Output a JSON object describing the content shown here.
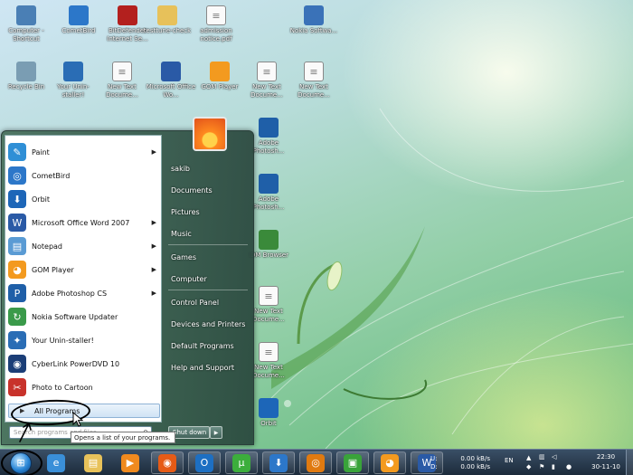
{
  "desktop_icons": [
    {
      "label": "Computer - Shortcut",
      "icon": "computer-icon",
      "color": "#4a7fb5"
    },
    {
      "label": "CometBird",
      "icon": "cometbird-icon",
      "color": "#2c77c9"
    },
    {
      "label": "BitDefender Internet Se...",
      "icon": "bitdefender-icon",
      "color": "#b3201e"
    },
    {
      "label": "testtune-check",
      "icon": "folder-icon",
      "color": "#e7c15a"
    },
    {
      "label": "admission notice.pdf",
      "icon": "pdf-icon",
      "color": "#d9d9d9"
    },
    {
      "label": "Nokia Softwa...",
      "icon": "nokia-icon",
      "color": "#3a72b8"
    },
    {
      "label": "Recycle Bin",
      "icon": "recycle-bin-icon",
      "color": "#7a9db3"
    },
    {
      "label": "Your Unin-staller!",
      "icon": "uninstaller-icon",
      "color": "#2a6db5"
    },
    {
      "label": "New Text Docume...",
      "icon": "text-document-icon",
      "color": "#ffffff"
    },
    {
      "label": "Microsoft Office Wo...",
      "icon": "word-icon",
      "color": "#2a5aa6"
    },
    {
      "label": "GOM Player",
      "icon": "gom-player-icon",
      "color": "#f39a1f"
    },
    {
      "label": "New Text Docume...",
      "icon": "text-document-icon",
      "color": "#ffffff"
    },
    {
      "label": "New Text Docume...",
      "icon": "text-document-icon",
      "color": "#ffffff"
    },
    {
      "label": "Adobe Photosh...",
      "icon": "photoshop-icon",
      "color": "#1f5fa8"
    },
    {
      "label": "Adobe Photosh...",
      "icon": "photoshop-icon",
      "color": "#1f5fa8"
    },
    {
      "label": "IDM Browser",
      "icon": "idm-icon",
      "color": "#3a8a3a"
    },
    {
      "label": "New Text Docume...",
      "icon": "text-document-icon",
      "color": "#ffffff"
    },
    {
      "label": "New Text Docume...",
      "icon": "text-document-icon",
      "color": "#ffffff"
    },
    {
      "label": "Orbit",
      "icon": "orbit-icon",
      "color": "#1d66b8"
    }
  ],
  "start_menu": {
    "programs": [
      {
        "label": "Paint",
        "icon": "paint-icon",
        "color": "#2f8fd6",
        "has_arrow": true
      },
      {
        "label": "CometBird",
        "icon": "cometbird-icon",
        "color": "#2c77c9",
        "has_arrow": false
      },
      {
        "label": "Orbit",
        "icon": "orbit-icon",
        "color": "#1d66b8",
        "has_arrow": false
      },
      {
        "label": "Microsoft Office Word 2007",
        "icon": "word-icon",
        "color": "#2a5aa6",
        "has_arrow": true
      },
      {
        "label": "Notepad",
        "icon": "notepad-icon",
        "color": "#5a9bd4",
        "has_arrow": true
      },
      {
        "label": "GOM Player",
        "icon": "gom-player-icon",
        "color": "#f39a1f",
        "has_arrow": true
      },
      {
        "label": "Adobe Photoshop CS",
        "icon": "photoshop-icon",
        "color": "#1f5fa8",
        "has_arrow": true
      },
      {
        "label": "Nokia Software Updater",
        "icon": "nokia-icon",
        "color": "#3a9a4a",
        "has_arrow": false
      },
      {
        "label": "Your Unin-staller!",
        "icon": "uninstaller-icon",
        "color": "#2a6db5",
        "has_arrow": false
      },
      {
        "label": "CyberLink PowerDVD 10",
        "icon": "powerdvd-icon",
        "color": "#1b3e77",
        "has_arrow": false
      },
      {
        "label": "Photo to Cartoon",
        "icon": "photo-to-cartoon-icon",
        "color": "#c8322b",
        "has_arrow": false
      }
    ],
    "all_programs": "All Programs",
    "search_placeholder": "Search programs and files",
    "right_items": [
      {
        "label": "sakib",
        "name": "right-item-user"
      },
      {
        "label": "Documents",
        "name": "right-item-documents"
      },
      {
        "label": "Pictures",
        "name": "right-item-pictures"
      },
      {
        "label": "Music",
        "name": "right-item-music"
      },
      {
        "label": "Games",
        "name": "right-item-games"
      },
      {
        "label": "Computer",
        "name": "right-item-computer"
      },
      {
        "label": "Control Panel",
        "name": "right-item-control-panel"
      },
      {
        "label": "Devices and Printers",
        "name": "right-item-devices-printers"
      },
      {
        "label": "Default Programs",
        "name": "right-item-default-programs"
      },
      {
        "label": "Help and Support",
        "name": "right-item-help-support"
      }
    ],
    "shutdown": "Shut down",
    "tooltip": "Opens a list of your programs."
  },
  "taskbar": {
    "pinned": [
      {
        "icon": "ie-icon",
        "color": "#3a8fd8",
        "glyph": "e"
      },
      {
        "icon": "explorer-icon",
        "color": "#e8c25a",
        "glyph": "▤"
      },
      {
        "icon": "media-player-icon",
        "color": "#f08a1e",
        "glyph": "▶"
      },
      {
        "icon": "firefox-icon",
        "color": "#e65b16",
        "glyph": "◉"
      },
      {
        "icon": "outlook-icon",
        "color": "#1d6fc2",
        "glyph": "O"
      },
      {
        "icon": "utorrent-icon",
        "color": "#3cae3c",
        "glyph": "µ"
      },
      {
        "icon": "idm-download-icon",
        "color": "#2c77c9",
        "glyph": "⬇"
      },
      {
        "icon": "cometbird-icon",
        "color": "#e07a10",
        "glyph": "◎"
      },
      {
        "icon": "nokia-pc-suite-icon",
        "color": "#39a33a",
        "glyph": "▣"
      },
      {
        "icon": "gom-player-icon",
        "color": "#f39a1f",
        "glyph": "◕"
      },
      {
        "icon": "word-icon",
        "color": "#2a5aa6",
        "glyph": "W"
      }
    ],
    "net_up_label": "U:",
    "net_up_value": "0.00 kB/s",
    "net_down_label": "D:",
    "net_down_value": "0.00 kB/s",
    "language": "EN",
    "time": "22:30",
    "date": "30-11-10"
  }
}
